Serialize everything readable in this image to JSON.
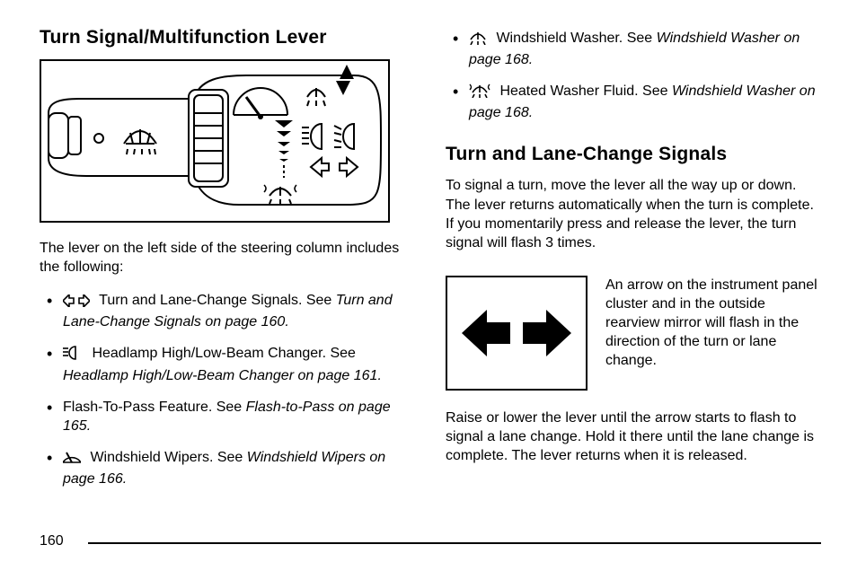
{
  "page_number": "160",
  "left": {
    "heading": "Turn Signal/Multifunction Lever",
    "intro": "The lever on the left side of the steering column includes the following:",
    "items": [
      {
        "text": "Turn and Lane-Change Signals. See ",
        "ref": "Turn and Lane-Change Signals on page 160.",
        "icon": "turn-arrows-icon"
      },
      {
        "text": "Headlamp High/Low-Beam Changer. See ",
        "ref": "Headlamp High/Low-Beam Changer on page 161.",
        "icon": "headlamp-icon"
      },
      {
        "text": "Flash-To-Pass Feature. See ",
        "ref": "Flash-to-Pass on page 165.",
        "icon": null
      },
      {
        "text": "Windshield Wipers. See ",
        "ref": "Windshield Wipers on page 166.",
        "icon": "wiper-icon"
      }
    ]
  },
  "right": {
    "top_items": [
      {
        "text": "Windshield Washer. See ",
        "ref": "Windshield Washer on page 168.",
        "icon": "washer-icon"
      },
      {
        "text": "Heated Washer Fluid. See ",
        "ref": "Windshield Washer on page 168.",
        "icon": "heated-washer-icon"
      }
    ],
    "heading": "Turn and Lane-Change Signals",
    "para1": "To signal a turn, move the lever all the way up or down. The lever returns automatically when the turn is complete. If you momentarily press and release the lever, the turn signal will flash 3 times.",
    "arrow_caption": "An arrow on the instrument panel cluster and in the outside rearview mirror will flash in the direction of the turn or lane change.",
    "para2": "Raise or lower the lever until the arrow starts to flash to signal a lane change. Hold it there until the lane change is complete. The lever returns when it is released."
  }
}
